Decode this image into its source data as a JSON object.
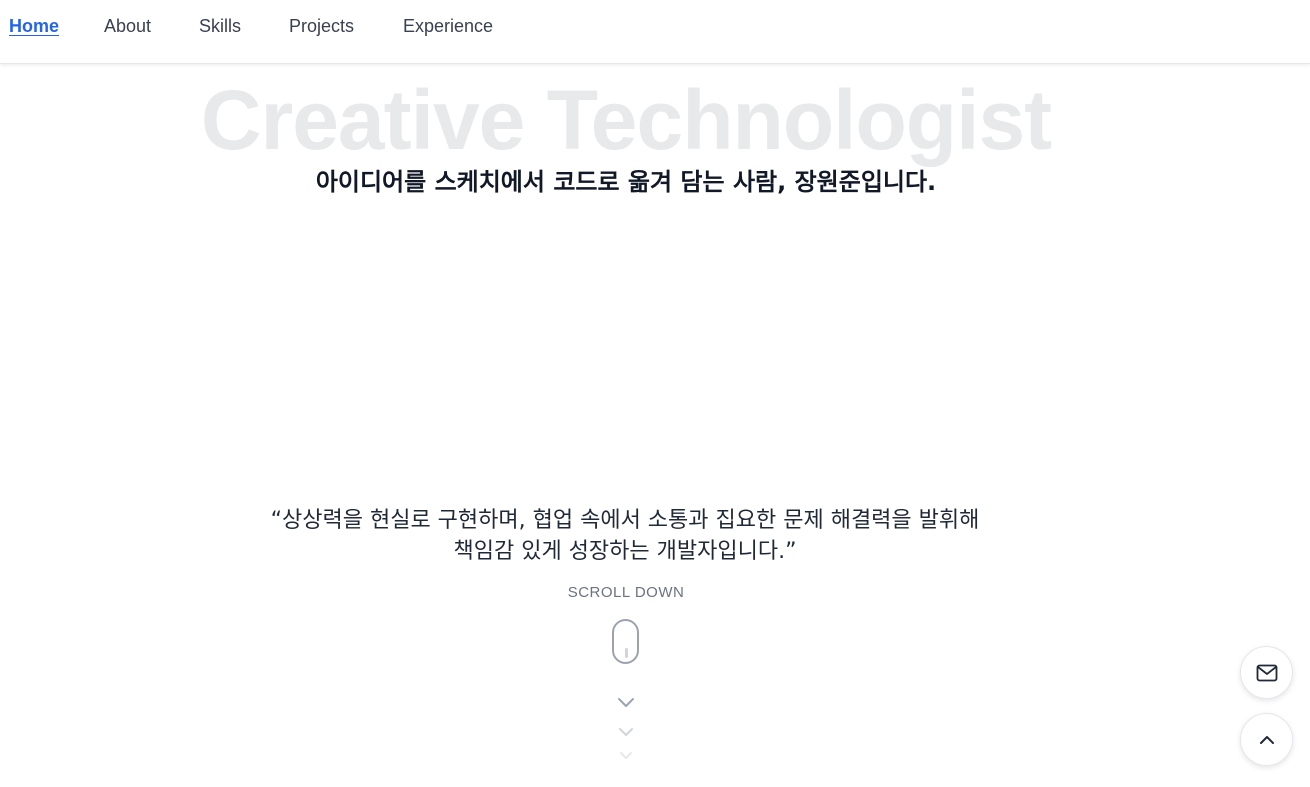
{
  "nav": {
    "items": [
      {
        "label": "Home",
        "active": true
      },
      {
        "label": "About",
        "active": false
      },
      {
        "label": "Skills",
        "active": false
      },
      {
        "label": "Projects",
        "active": false
      },
      {
        "label": "Experience",
        "active": false
      }
    ]
  },
  "hero": {
    "background_title": "Creative Technologist",
    "subtitle": "아이디어를 스케치에서 코드로 옮겨 담는 사람, 장원준입니다.",
    "quote_line1": "“상상력을 현실로 구현하며, 협업 속에서 소통과 집요한 문제 해결력을 발휘해",
    "quote_line2": "책임감 있게 성장하는 개발자입니다.”",
    "scroll_label": "SCROLL DOWN"
  },
  "floating": {
    "mail_icon": "mail-icon",
    "top_icon": "chevron-up-icon"
  },
  "colors": {
    "accent": "#2563eb",
    "text": "#111827",
    "muted": "#6b7280",
    "ghost_title": "#e8e9eb"
  }
}
